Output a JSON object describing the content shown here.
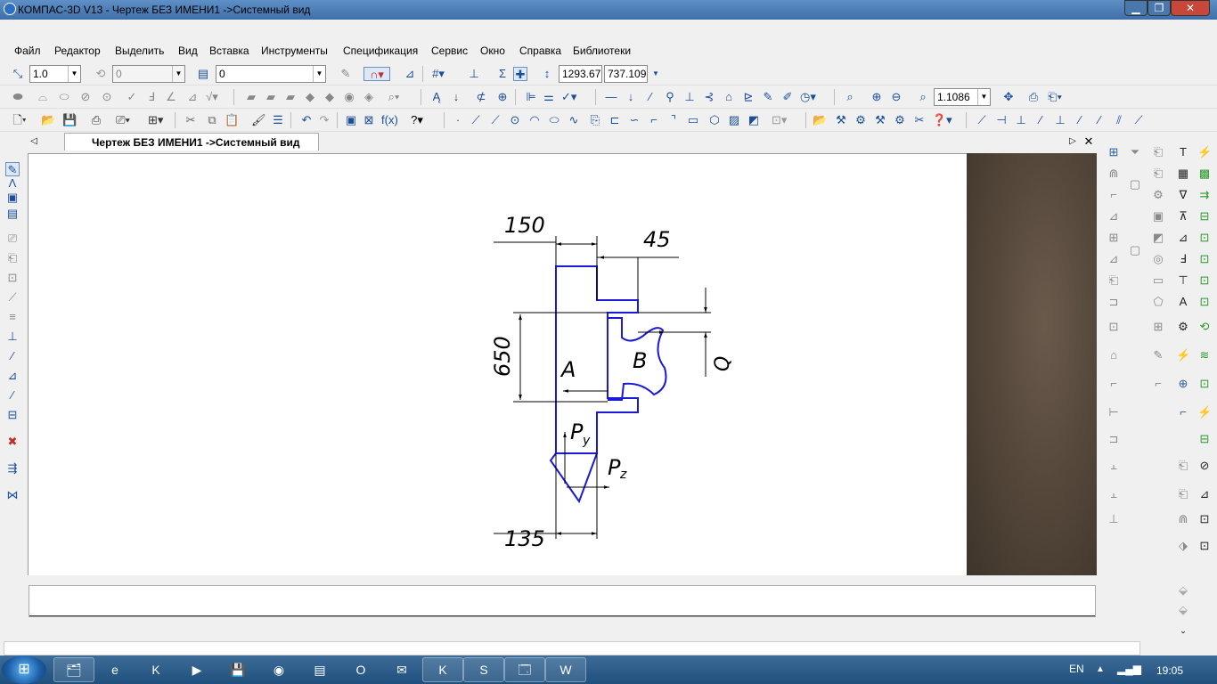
{
  "window": {
    "title": "КОМПАС-3D V13 - Чертеж БЕЗ ИМЕНИ1 ->Системный вид"
  },
  "menu": [
    "Файл",
    "Редактор",
    "Выделить",
    "Вид",
    "Вставка",
    "Инструменты",
    "Спецификация",
    "Сервис",
    "Окно",
    "Справка",
    "Библиотеки"
  ],
  "toolbar": {
    "step": "1.0",
    "angle": "0",
    "layer": "0",
    "x_coord": "1293.67",
    "y_coord": "737.109",
    "zoom": "1.1086"
  },
  "document_tab": {
    "label": "Чертеж БЕЗ ИМЕНИ1 ->Системный вид"
  },
  "drawing": {
    "dim_top": "150",
    "dim_right": "45",
    "dim_left": "650",
    "dim_bottom": "135",
    "label_a": "A",
    "label_b": "B",
    "label_q": "Q",
    "label_py": "P",
    "label_py_sub": "y",
    "label_pz": "P",
    "label_pz_sub": "z",
    "line_color": "#1a1ad6"
  },
  "taskbar": {
    "lang": "EN",
    "clock": "19:05"
  }
}
